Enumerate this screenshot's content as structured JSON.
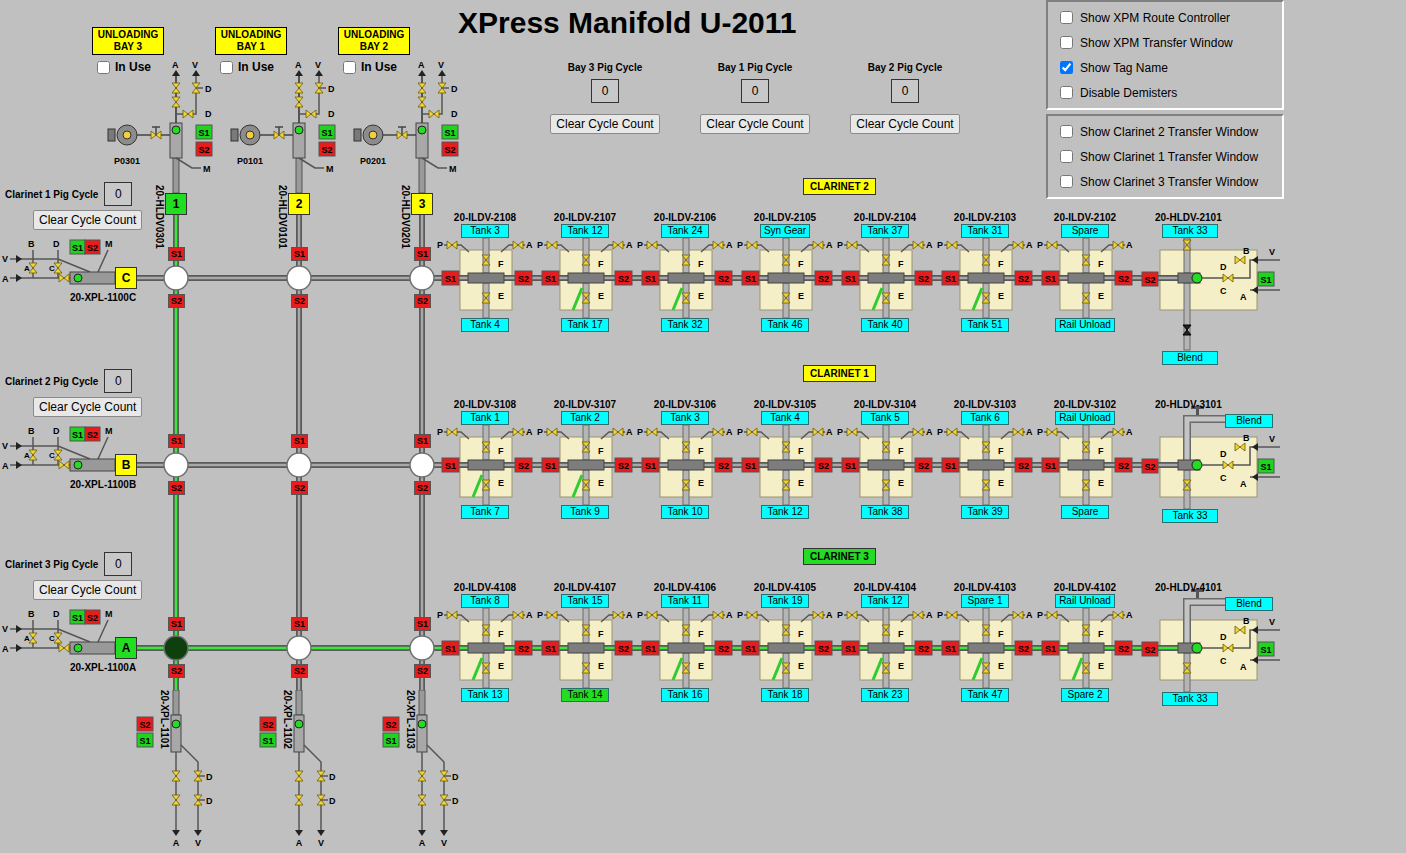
{
  "title": "XPress Manifold U-2011",
  "labels": {
    "s1": "S1",
    "s2": "S2",
    "p": "P",
    "a": "A",
    "f": "F",
    "e": "E",
    "v": "V",
    "b": "B",
    "c": "C",
    "d": "D",
    "m": "M"
  },
  "options": [
    [
      {
        "label": "Show XPM Route Controller",
        "checked": false
      },
      {
        "label": "Show XPM Transfer Window",
        "checked": false
      },
      {
        "label": "Show Tag Name",
        "checked": true
      },
      {
        "label": "Disable Demisters",
        "checked": false
      }
    ],
    [
      {
        "label": "Show Clarinet 2 Transfer Window",
        "checked": false
      },
      {
        "label": "Show Clarinet 1 Transfer Window",
        "checked": false
      },
      {
        "label": "Show Clarinet 3 Transfer Window",
        "checked": false
      }
    ]
  ],
  "bays": [
    {
      "label": "UNLOADING BAY 3",
      "in_use": {
        "label": "In Use",
        "checked": false
      },
      "pig_cycle": {
        "label": "Bay 3 Pig Cycle",
        "count": "0",
        "button": "Clear Cycle Count"
      },
      "pump": "P0301",
      "valve_tag": "20-HLDV0301",
      "number": "1",
      "number_color": "#22dd22",
      "line_active": true,
      "s1_on": true,
      "s2_on": false
    },
    {
      "label": "UNLOADING BAY 1",
      "in_use": {
        "label": "In Use",
        "checked": false
      },
      "pig_cycle": {
        "label": "Bay 1 Pig Cycle",
        "count": "0",
        "button": "Clear Cycle Count"
      },
      "pump": "P0101",
      "valve_tag": "20-HLDV0101",
      "number": "2",
      "number_color": "#ffff00",
      "line_active": false,
      "s1_on": true,
      "s2_on": false
    },
    {
      "label": "UNLOADING BAY 2",
      "in_use": {
        "label": "In Use",
        "checked": false
      },
      "pig_cycle": {
        "label": "Bay 2 Pig Cycle",
        "count": "0",
        "button": "Clear Cycle Count"
      },
      "pump": "P0201",
      "valve_tag": "20-HLDV0201",
      "number": "3",
      "number_color": "#ffff00",
      "line_active": false,
      "s1_on": true,
      "s2_on": false
    }
  ],
  "clarinets": [
    {
      "label": "CLARINET 2",
      "color": "#ffff00",
      "active": false,
      "launcher": {
        "pig_cycle": {
          "label": "Clarinet 1 Pig Cycle",
          "count": "0",
          "button": "Clear Cycle Count"
        },
        "tag": "20-XPL-1100C",
        "letter": "C",
        "letter_color": "#ffff00",
        "s1_on": true,
        "s2_on": false
      },
      "nodes": [
        {
          "open": false,
          "s1_on": false,
          "s2_on": false
        },
        {
          "open": false,
          "s1_on": false,
          "s2_on": false
        },
        {
          "open": false,
          "s1_on": false,
          "s2_on": false
        }
      ],
      "valves": [
        {
          "tag": "20-ILDV-2108",
          "top": {
            "text": "Tank 3",
            "selected": false
          },
          "bottom": {
            "text": "Tank 4",
            "selected": false
          },
          "flow": false,
          "s1_on": false,
          "s2_on": false
        },
        {
          "tag": "20-ILDV-2107",
          "top": {
            "text": "Tank 12",
            "selected": false
          },
          "bottom": {
            "text": "Tank 17",
            "selected": false
          },
          "flow": true,
          "s1_on": false,
          "s2_on": false
        },
        {
          "tag": "20-ILDV-2106",
          "top": {
            "text": "Tank 24",
            "selected": false
          },
          "bottom": {
            "text": "Tank 32",
            "selected": false
          },
          "flow": true,
          "s1_on": false,
          "s2_on": false
        },
        {
          "tag": "20-ILDV-2105",
          "top": {
            "text": "Syn Gear",
            "selected": false
          },
          "bottom": {
            "text": "Tank 46",
            "selected": false
          },
          "flow": false,
          "s1_on": false,
          "s2_on": false
        },
        {
          "tag": "20-ILDV-2104",
          "top": {
            "text": "Tank 37",
            "selected": false
          },
          "bottom": {
            "text": "Tank 40",
            "selected": false
          },
          "flow": true,
          "s1_on": false,
          "s2_on": false
        },
        {
          "tag": "20-ILDV-2103",
          "top": {
            "text": "Tank 31",
            "selected": false
          },
          "bottom": {
            "text": "Tank 51",
            "selected": false
          },
          "flow": true,
          "s1_on": false,
          "s2_on": false
        },
        {
          "tag": "20-ILDV-2102",
          "top": {
            "text": "Spare",
            "selected": false
          },
          "bottom": {
            "text": "Rail Unload",
            "selected": false
          },
          "flow": false,
          "s1_on": false,
          "s2_on": false
        }
      ],
      "header": {
        "tag": "20-HLDV-2101",
        "kind": "blend-below",
        "top": {
          "text": "Tank 33"
        },
        "bottom": {
          "text": "Blend"
        },
        "s1_on": true,
        "s2_on": false
      }
    },
    {
      "label": "CLARINET 1",
      "color": "#ffff00",
      "active": false,
      "launcher": {
        "pig_cycle": {
          "label": "Clarinet 2 Pig Cycle",
          "count": "0",
          "button": "Clear Cycle Count"
        },
        "tag": "20-XPL-1100B",
        "letter": "B",
        "letter_color": "#ffff00",
        "s1_on": true,
        "s2_on": false
      },
      "nodes": [
        {
          "open": false,
          "s1_on": false,
          "s2_on": false
        },
        {
          "open": false,
          "s1_on": false,
          "s2_on": false
        },
        {
          "open": false,
          "s1_on": false,
          "s2_on": false
        }
      ],
      "valves": [
        {
          "tag": "20-ILDV-3108",
          "top": {
            "text": "Tank 1",
            "selected": false
          },
          "bottom": {
            "text": "Tank 7",
            "selected": false
          },
          "flow": true,
          "s1_on": false,
          "s2_on": false
        },
        {
          "tag": "20-ILDV-3107",
          "top": {
            "text": "Tank 2",
            "selected": false
          },
          "bottom": {
            "text": "Tank 9",
            "selected": false
          },
          "flow": true,
          "s1_on": false,
          "s2_on": false
        },
        {
          "tag": "20-ILDV-3106",
          "top": {
            "text": "Tank 3",
            "selected": false
          },
          "bottom": {
            "text": "Tank 10",
            "selected": false
          },
          "flow": false,
          "s1_on": false,
          "s2_on": false
        },
        {
          "tag": "20-ILDV-3105",
          "top": {
            "text": "Tank 4",
            "selected": false
          },
          "bottom": {
            "text": "Tank 12",
            "selected": false
          },
          "flow": false,
          "s1_on": false,
          "s2_on": false
        },
        {
          "tag": "20-ILDV-3104",
          "top": {
            "text": "Tank 5",
            "selected": false
          },
          "bottom": {
            "text": "Tank 38",
            "selected": false
          },
          "flow": false,
          "s1_on": false,
          "s2_on": false
        },
        {
          "tag": "20-ILDV-3103",
          "top": {
            "text": "Tank 6",
            "selected": false
          },
          "bottom": {
            "text": "Tank 39",
            "selected": false
          },
          "flow": false,
          "s1_on": false,
          "s2_on": false
        },
        {
          "tag": "20-ILDV-3102",
          "top": {
            "text": "Rail Unload",
            "selected": false
          },
          "bottom": {
            "text": "Spare",
            "selected": false
          },
          "flow": false,
          "s1_on": false,
          "s2_on": false
        }
      ],
      "header": {
        "tag": "20-HLDV-3101",
        "kind": "blend-side",
        "top": {
          "text": "Blend"
        },
        "bottom": {
          "text": "Tank 33"
        },
        "s1_on": true,
        "s2_on": false
      }
    },
    {
      "label": "CLARINET 3",
      "color": "#22dd22",
      "active": true,
      "launcher": {
        "pig_cycle": {
          "label": "Clarinet 3 Pig Cycle",
          "count": "0",
          "button": "Clear Cycle Count"
        },
        "tag": "20-XPL-1100A",
        "letter": "A",
        "letter_color": "#22dd22",
        "s1_on": true,
        "s2_on": false
      },
      "nodes": [
        {
          "open": true,
          "s1_on": false,
          "s2_on": false
        },
        {
          "open": false,
          "s1_on": false,
          "s2_on": false
        },
        {
          "open": false,
          "s1_on": false,
          "s2_on": false
        }
      ],
      "valves": [
        {
          "tag": "20-ILDV-4108",
          "top": {
            "text": "Tank 8",
            "selected": false
          },
          "bottom": {
            "text": "Tank 13",
            "selected": false
          },
          "flow": true,
          "s1_on": false,
          "s2_on": false
        },
        {
          "tag": "20-ILDV-4107",
          "top": {
            "text": "Tank 15",
            "selected": false
          },
          "bottom": {
            "text": "Tank 14",
            "selected": true
          },
          "flow": false,
          "s1_on": false,
          "s2_on": false
        },
        {
          "tag": "20-ILDV-4106",
          "top": {
            "text": "Tank 11",
            "selected": false
          },
          "bottom": {
            "text": "Tank 16",
            "selected": false
          },
          "flow": true,
          "s1_on": false,
          "s2_on": false
        },
        {
          "tag": "20-ILDV-4105",
          "top": {
            "text": "Tank 19",
            "selected": false
          },
          "bottom": {
            "text": "Tank 18",
            "selected": false
          },
          "flow": true,
          "s1_on": false,
          "s2_on": false
        },
        {
          "tag": "20-ILDV-4104",
          "top": {
            "text": "Tank 12",
            "selected": false
          },
          "bottom": {
            "text": "Tank 23",
            "selected": false
          },
          "flow": true,
          "s1_on": false,
          "s2_on": false
        },
        {
          "tag": "20-ILDV-4103",
          "top": {
            "text": "Spare 1",
            "selected": false
          },
          "bottom": {
            "text": "Tank 47",
            "selected": false
          },
          "flow": true,
          "s1_on": false,
          "s2_on": false
        },
        {
          "tag": "20-ILDV-4102",
          "top": {
            "text": "Rail Unload",
            "selected": false
          },
          "bottom": {
            "text": "Spare 2",
            "selected": false
          },
          "flow": true,
          "s1_on": false,
          "s2_on": false
        }
      ],
      "header": {
        "tag": "20-HLDV-4101",
        "kind": "blend-side",
        "top": {
          "text": "Blend"
        },
        "bottom": {
          "text": "Tank 33"
        },
        "s1_on": true,
        "s2_on": false
      }
    }
  ],
  "receivers": [
    {
      "tag": "20-XPL-1101",
      "s1_on": true,
      "s2_on": false
    },
    {
      "tag": "20-XPL-1102",
      "s1_on": true,
      "s2_on": false
    },
    {
      "tag": "20-XPL-1103",
      "s1_on": true,
      "s2_on": false
    }
  ]
}
